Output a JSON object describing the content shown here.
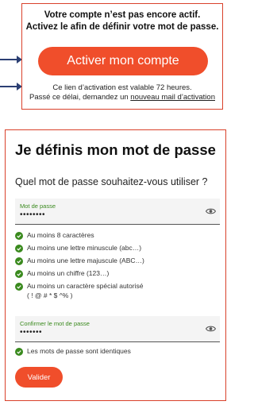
{
  "activation": {
    "title_line1": "Votre compte n’est pas encore actif.",
    "title_line2": "Activez le afin de définir votre mot de passe.",
    "button_label": "Activer mon compte",
    "info_line1_prefix": "Ce lien d’activation est valable ",
    "info_hours": "72",
    "info_line1_suffix": " heures.",
    "info_line2_prefix": "Passé ce délai, demandez un ",
    "info_link": "nouveau mail d’activation"
  },
  "form": {
    "title": "Je définis mon mot de passe",
    "question": "Quel mot de passe souhaitez-vous utiliser ?",
    "password": {
      "label": "Mot de passe",
      "value": "••••••••"
    },
    "rules": [
      "Au moins 8 caractères",
      "Au moins une lettre minuscule (abc…)",
      "Au moins une lettre majuscule (ABC…)",
      "Au moins un chiffre (123…)",
      "Au moins un caractère spécial autorisé"
    ],
    "special_chars": "( ! @ # * $ ^% )",
    "confirm": {
      "label": "Confirmer le mot de passe",
      "value": "•••••••"
    },
    "match_text": "Les mots de passe sont identiques",
    "submit_label": "Valider"
  },
  "colors": {
    "accent": "#f04e2b",
    "frame": "#d9412b",
    "check": "#3a8a1e",
    "arrow": "#2b3f73"
  },
  "icons": {
    "check": "check-circle-icon",
    "eye": "eye-icon",
    "arrow": "arrow-right-icon"
  }
}
